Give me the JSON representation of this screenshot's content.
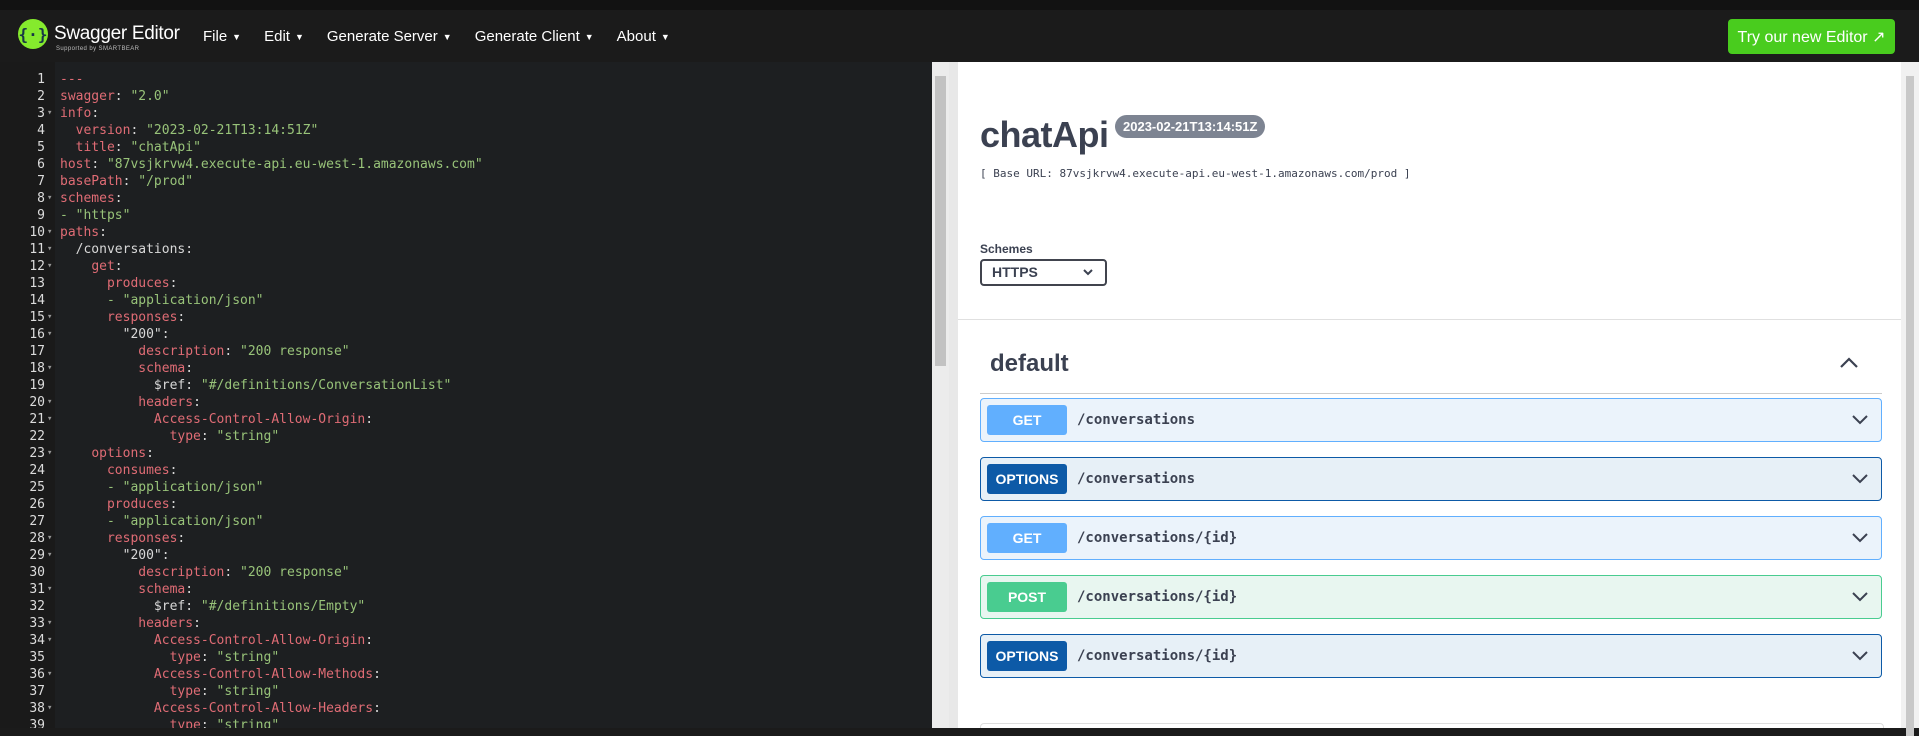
{
  "topbar": {
    "logo_text": "Swagger Editor",
    "logo_sub": "Supported by SMARTBEAR",
    "menu": [
      {
        "label": "File"
      },
      {
        "label": "Edit"
      },
      {
        "label": "Generate Server"
      },
      {
        "label": "Generate Client"
      },
      {
        "label": "About"
      }
    ],
    "try_button": "Try our new Editor ↗"
  },
  "editor": {
    "lines": [
      {
        "n": "1",
        "fold": false,
        "indent": "",
        "key": "",
        "val": "---"
      },
      {
        "n": "2",
        "fold": false,
        "indent": "",
        "key": "swagger",
        "val": "\"2.0\""
      },
      {
        "n": "3",
        "fold": true,
        "indent": "",
        "key": "info",
        "val": ""
      },
      {
        "n": "4",
        "fold": false,
        "indent": "  ",
        "key": "version",
        "val": "\"2023-02-21T13:14:51Z\""
      },
      {
        "n": "5",
        "fold": false,
        "indent": "  ",
        "key": "title",
        "val": "\"chatApi\""
      },
      {
        "n": "6",
        "fold": false,
        "indent": "",
        "key": "host",
        "val": "\"87vsjkrvw4.execute-api.eu-west-1.amazonaws.com\""
      },
      {
        "n": "7",
        "fold": false,
        "indent": "",
        "key": "basePath",
        "val": "\"/prod\""
      },
      {
        "n": "8",
        "fold": true,
        "indent": "",
        "key": "schemes",
        "val": ""
      },
      {
        "n": "9",
        "fold": false,
        "indent": "",
        "key": "",
        "val": "- \"https\""
      },
      {
        "n": "10",
        "fold": true,
        "indent": "",
        "key": "paths",
        "val": ""
      },
      {
        "n": "11",
        "fold": true,
        "indent": "  ",
        "key": "",
        "val": "/conversations:",
        "plain": true
      },
      {
        "n": "12",
        "fold": true,
        "indent": "    ",
        "key": "get",
        "val": ""
      },
      {
        "n": "13",
        "fold": false,
        "indent": "      ",
        "key": "produces",
        "val": ""
      },
      {
        "n": "14",
        "fold": false,
        "indent": "      ",
        "key": "",
        "val": "- \"application/json\""
      },
      {
        "n": "15",
        "fold": true,
        "indent": "      ",
        "key": "responses",
        "val": ""
      },
      {
        "n": "16",
        "fold": true,
        "indent": "        ",
        "key": "",
        "val": "\"200\":",
        "plain": true
      },
      {
        "n": "17",
        "fold": false,
        "indent": "          ",
        "key": "description",
        "val": "\"200 response\""
      },
      {
        "n": "18",
        "fold": true,
        "indent": "          ",
        "key": "schema",
        "val": ""
      },
      {
        "n": "19",
        "fold": false,
        "indent": "            ",
        "key": "$ref",
        "val": "\"#/definitions/ConversationList\"",
        "refkey": true
      },
      {
        "n": "20",
        "fold": true,
        "indent": "          ",
        "key": "headers",
        "val": ""
      },
      {
        "n": "21",
        "fold": true,
        "indent": "            ",
        "key": "Access-Control-Allow-Origin",
        "val": ""
      },
      {
        "n": "22",
        "fold": false,
        "indent": "              ",
        "key": "type",
        "val": "\"string\""
      },
      {
        "n": "23",
        "fold": true,
        "indent": "    ",
        "key": "options",
        "val": ""
      },
      {
        "n": "24",
        "fold": false,
        "indent": "      ",
        "key": "consumes",
        "val": ""
      },
      {
        "n": "25",
        "fold": false,
        "indent": "      ",
        "key": "",
        "val": "- \"application/json\""
      },
      {
        "n": "26",
        "fold": false,
        "indent": "      ",
        "key": "produces",
        "val": ""
      },
      {
        "n": "27",
        "fold": false,
        "indent": "      ",
        "key": "",
        "val": "- \"application/json\""
      },
      {
        "n": "28",
        "fold": true,
        "indent": "      ",
        "key": "responses",
        "val": ""
      },
      {
        "n": "29",
        "fold": true,
        "indent": "        ",
        "key": "",
        "val": "\"200\":",
        "plain": true
      },
      {
        "n": "30",
        "fold": false,
        "indent": "          ",
        "key": "description",
        "val": "\"200 response\""
      },
      {
        "n": "31",
        "fold": true,
        "indent": "          ",
        "key": "schema",
        "val": ""
      },
      {
        "n": "32",
        "fold": false,
        "indent": "            ",
        "key": "$ref",
        "val": "\"#/definitions/Empty\"",
        "refkey": true
      },
      {
        "n": "33",
        "fold": true,
        "indent": "          ",
        "key": "headers",
        "val": ""
      },
      {
        "n": "34",
        "fold": true,
        "indent": "            ",
        "key": "Access-Control-Allow-Origin",
        "val": ""
      },
      {
        "n": "35",
        "fold": false,
        "indent": "              ",
        "key": "type",
        "val": "\"string\""
      },
      {
        "n": "36",
        "fold": true,
        "indent": "            ",
        "key": "Access-Control-Allow-Methods",
        "val": ""
      },
      {
        "n": "37",
        "fold": false,
        "indent": "              ",
        "key": "type",
        "val": "\"string\""
      },
      {
        "n": "38",
        "fold": true,
        "indent": "            ",
        "key": "Access-Control-Allow-Headers",
        "val": ""
      },
      {
        "n": "39",
        "fold": false,
        "indent": "              ",
        "key": "type",
        "val": "\"string\""
      }
    ]
  },
  "preview": {
    "title": "chatApi",
    "version": "2023-02-21T13:14:51Z",
    "base_url": "[ Base URL: 87vsjkrvw4.execute-api.eu-west-1.amazonaws.com/prod ]",
    "schemes_label": "Schemes",
    "scheme_selected": "HTTPS",
    "tag": "default",
    "operations": [
      {
        "method": "GET",
        "cls": "get",
        "path": "/conversations"
      },
      {
        "method": "OPTIONS",
        "cls": "options",
        "path": "/conversations"
      },
      {
        "method": "GET",
        "cls": "get",
        "path": "/conversations/{id}"
      },
      {
        "method": "POST",
        "cls": "post",
        "path": "/conversations/{id}"
      },
      {
        "method": "OPTIONS",
        "cls": "options",
        "path": "/conversations/{id}"
      }
    ]
  }
}
